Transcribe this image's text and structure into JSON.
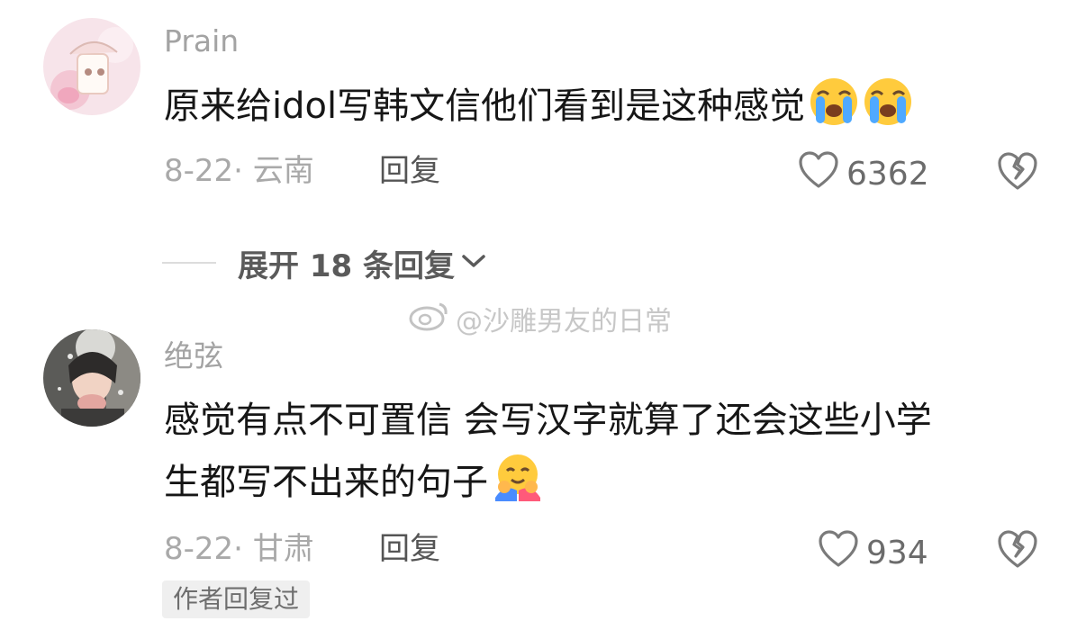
{
  "comments": [
    {
      "username": "Prain",
      "text": "原来给idol写韩文信他们看到是这种感觉",
      "emojis": [
        "loudly-crying-face-emoji",
        "loudly-crying-face-emoji"
      ],
      "date": "8-22",
      "location": "云南",
      "meta": "8-22· 云南",
      "reply_label": "回复",
      "likes": "6362"
    },
    {
      "username": "绝弦",
      "text_line1": "感觉有点不可置信 会写汉字就算了还会这些小学",
      "text_line2": "生都写不出来的句子",
      "emojis": [
        "hugging-face-emoji"
      ],
      "date": "8-22",
      "location": "甘肃",
      "meta": "8-22· 甘肃",
      "reply_label": "回复",
      "likes": "934",
      "badge": "作者回复过"
    }
  ],
  "expand_replies": {
    "label": "展开 18 条回复"
  },
  "watermark": {
    "text": "@沙雕男友的日常"
  },
  "icons": {
    "like": "heart-outline-icon",
    "dislike": "broken-heart-icon",
    "expand": "chevron-down-icon",
    "watermark": "weibo-logo-icon"
  }
}
